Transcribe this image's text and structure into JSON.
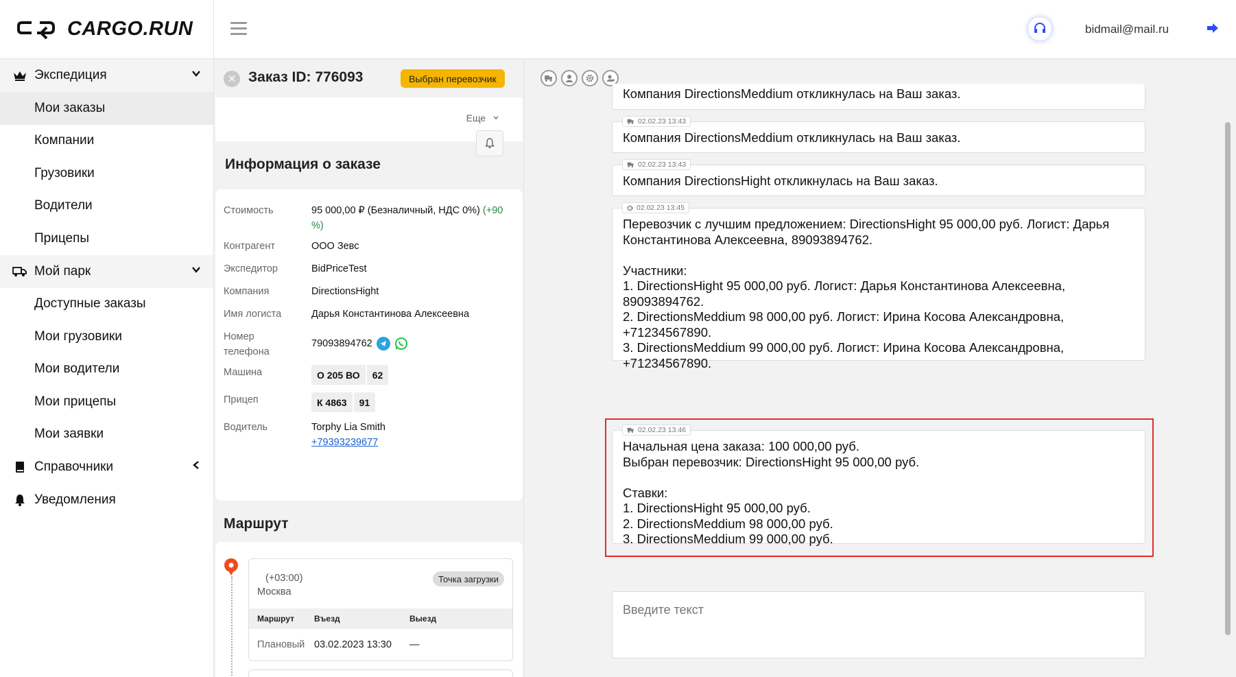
{
  "app": {
    "logo": "CARGO.RUN"
  },
  "header": {
    "user_email": "bidmail@mail.ru"
  },
  "sidebar": {
    "expedition": {
      "label": "Экспедиция",
      "items": [
        "Мои заказы",
        "Компании",
        "Грузовики",
        "Водители",
        "Прицепы"
      ]
    },
    "park": {
      "label": "Мой парк",
      "items": [
        "Доступные заказы",
        "Мои грузовики",
        "Мои водители",
        "Мои прицепы",
        "Мои заявки"
      ]
    },
    "reference": {
      "label": "Справочники"
    },
    "notifications": {
      "label": "Уведомления"
    }
  },
  "order": {
    "title": "Заказ ID: 776093",
    "status": "Выбран перевозчик",
    "more": "Еще",
    "info_title": "Информация о заказе",
    "fields": {
      "cost_label": "Стоимость",
      "cost_value": "95 000,00 ₽ (Безналичный, НДС 0%)",
      "cost_extra": "(+90 %)",
      "counterparty_label": "Контрагент",
      "counterparty_value": "ООО Зевс",
      "forwarder_label": "Экспедитор",
      "forwarder_value": "BidPriceTest",
      "company_label": "Компания",
      "company_value": "DirectionsHight",
      "logist_label": "Имя логиста",
      "logist_value": "Дарья Константинова Алексеевна",
      "phone_label": "Номер телефона",
      "phone_value": "79093894762",
      "car_label": "Машина",
      "car_plate": "О 205 ВО",
      "car_region": "62",
      "trailer_label": "Прицеп",
      "trailer_plate": "К 4863",
      "trailer_region": "91",
      "driver_label": "Водитель",
      "driver_name": "Torphy Lia Smith",
      "driver_phone": "+79393239677"
    },
    "route": {
      "title": "Маршрут",
      "tz": "(+03:00)",
      "city": "Москва",
      "point_type": "Точка загрузки",
      "columns": [
        "Маршрут",
        "Въезд",
        "Выезд"
      ],
      "row": [
        "Плановый",
        "03.02.2023 13:30",
        "—"
      ]
    }
  },
  "chat": {
    "messages": [
      {
        "time": "",
        "text": "Компания DirectionsMeddium откликнулась на Ваш заказ."
      },
      {
        "time": "02.02.23 13:43",
        "text": "Компания DirectionsMeddium откликнулась на Ваш заказ."
      },
      {
        "time": "02.02.23 13:43",
        "text": "Компания DirectionsHight откликнулась на Ваш заказ."
      },
      {
        "time": "02.02.23 13:45",
        "text": "Перевозчик с лучшим предложением: DirectionsHight 95 000,00 руб. Логист: Дарья Константинова Алексеевна, 89093894762.\n\nУчастники:\n1. DirectionsHight 95 000,00 руб. Логист: Дарья Константинова Алексеевна, 89093894762.\n2. DirectionsMeddium 98 000,00 руб. Логист: Ирина Косова Александровна, +71234567890.\n3. DirectionsMeddium 99 000,00 руб. Логист: Ирина Косова Александровна, +71234567890."
      },
      {
        "time": "02.02.23 13:46",
        "text": "Начальная цена заказа: 100 000,00 руб.\nВыбран перевозчик: DirectionsHight 95 000,00 руб.\n\nСтавки:\n1. DirectionsHight 95 000,00 руб.\n2. DirectionsMeddium 98 000,00 руб.\n3. DirectionsMeddium 99 000,00 руб."
      }
    ],
    "input_placeholder": "Введите текст"
  },
  "colors": {
    "accent_badge": "#f6b500",
    "highlight": "#e42b2b",
    "link": "#1a5fd0",
    "green": "#1f8a45"
  }
}
